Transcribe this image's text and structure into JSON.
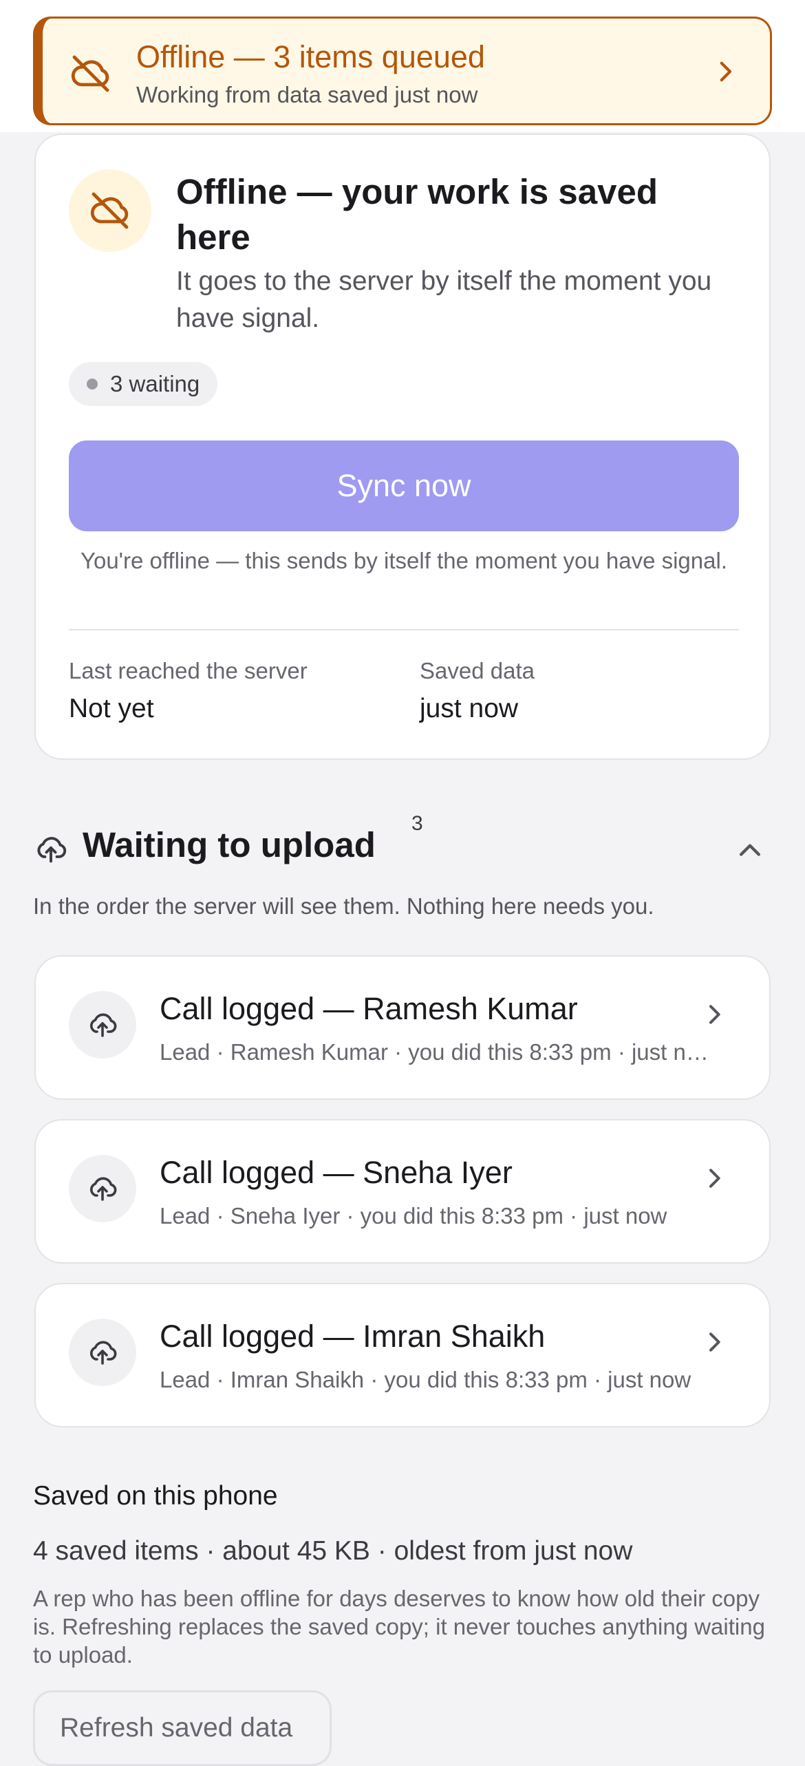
{
  "banner": {
    "title": "Offline — 3 items queued",
    "subtitle": "Working from data saved just now",
    "icon": "cloud-off-icon",
    "accent": "#b4560b",
    "background": "#fff8e6"
  },
  "status_card": {
    "title": "Offline — your work is saved here",
    "description": "It goes to the server by itself the moment you have signal.",
    "waiting_pill": "3 waiting",
    "sync_button": "Sync now",
    "sync_note": "You're offline — this sends by itself the moment you have signal.",
    "last_reached_label": "Last reached the server",
    "last_reached_value": "Not yet",
    "saved_data_label": "Saved data",
    "saved_data_value": "just now",
    "sync_button_color": "#9f9bf1"
  },
  "queue": {
    "title": "Waiting to upload",
    "count": "3",
    "description": "In the order the server will see them. Nothing here needs you.",
    "items": [
      {
        "title": "Call logged — Ramesh Kumar",
        "subtitle": "Lead · Ramesh Kumar · you did this 8:33 pm · just now"
      },
      {
        "title": "Call logged — Sneha Iyer",
        "subtitle": "Lead · Sneha Iyer · you did this 8:33 pm · just now"
      },
      {
        "title": "Call logged — Imran Shaikh",
        "subtitle": "Lead · Imran Shaikh · you did this 8:33 pm · just now"
      }
    ]
  },
  "saved": {
    "title": "Saved on this phone",
    "summary": "4 saved items · about 45 KB · oldest from just now",
    "note": "A rep who has been offline for days deserves to know how old their copy is. Refreshing replaces the saved copy; it never touches anything waiting to upload.",
    "refresh_button": "Refresh saved data"
  }
}
